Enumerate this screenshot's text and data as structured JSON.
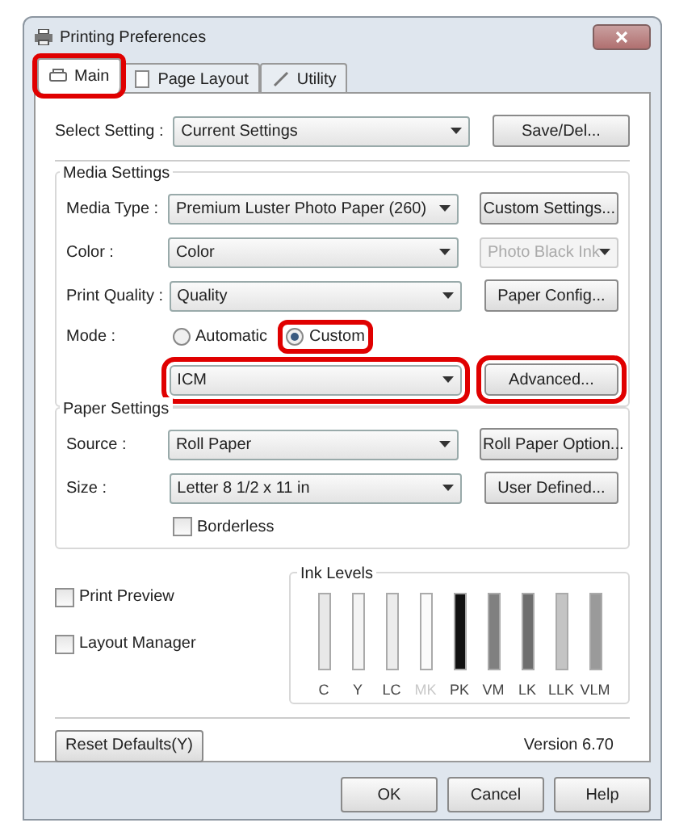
{
  "window": {
    "title": "Printing Preferences"
  },
  "tabs": [
    {
      "label": "Main",
      "selected": true,
      "highlighted": true
    },
    {
      "label": "Page Layout",
      "selected": false,
      "highlighted": false
    },
    {
      "label": "Utility",
      "selected": false,
      "highlighted": false
    }
  ],
  "select_setting": {
    "label": "Select Setting :",
    "value": "Current Settings",
    "button": "Save/Del..."
  },
  "media_settings": {
    "title": "Media Settings",
    "rows": [
      {
        "label": "Media Type :",
        "value": "Premium Luster Photo Paper (260)",
        "side": {
          "kind": "button",
          "label": "Custom Settings...",
          "disabled": false
        }
      },
      {
        "label": "Color :",
        "value": "Color",
        "side": {
          "kind": "combo",
          "label": "Photo Black Ink",
          "disabled": true
        }
      },
      {
        "label": "Print Quality :",
        "value": "Quality",
        "side": {
          "kind": "button",
          "label": "Paper Config...",
          "disabled": false
        }
      }
    ],
    "mode": {
      "label": "Mode :",
      "options": [
        {
          "label": "Automatic",
          "selected": false,
          "highlighted": false
        },
        {
          "label": "Custom",
          "selected": true,
          "highlighted": true
        }
      ],
      "dropdown": {
        "value": "ICM",
        "highlighted": true
      },
      "button": {
        "label": "Advanced...",
        "highlighted": true
      }
    }
  },
  "paper_settings": {
    "title": "Paper Settings",
    "rows": [
      {
        "label": "Source :",
        "value": "Roll Paper",
        "button": "Roll Paper Option..."
      },
      {
        "label": "Size :",
        "value": "Letter 8 1/2 x 11 in",
        "button": "User Defined..."
      }
    ],
    "borderless": {
      "label": "Borderless",
      "checked": false
    }
  },
  "options": [
    {
      "label": "Print Preview",
      "checked": false
    },
    {
      "label": "Layout Manager",
      "checked": false
    }
  ],
  "ink_levels": {
    "title": "Ink Levels",
    "inks": [
      {
        "label": "C",
        "color": "#e8e8e8",
        "disabled": false
      },
      {
        "label": "Y",
        "color": "#f4f4f4",
        "disabled": false
      },
      {
        "label": "LC",
        "color": "#ececec",
        "disabled": false
      },
      {
        "label": "MK",
        "color": "#fafafa",
        "disabled": true
      },
      {
        "label": "PK",
        "color": "#111111",
        "disabled": false
      },
      {
        "label": "VM",
        "color": "#808080",
        "disabled": false
      },
      {
        "label": "LK",
        "color": "#6e6e6e",
        "disabled": false
      },
      {
        "label": "LLK",
        "color": "#c4c4c4",
        "disabled": false
      },
      {
        "label": "VLM",
        "color": "#9a9a9a",
        "disabled": false
      }
    ]
  },
  "reset_button": "Reset Defaults(Y)",
  "version": "Version 6.70",
  "buttons": [
    "OK",
    "Cancel",
    "Help"
  ]
}
